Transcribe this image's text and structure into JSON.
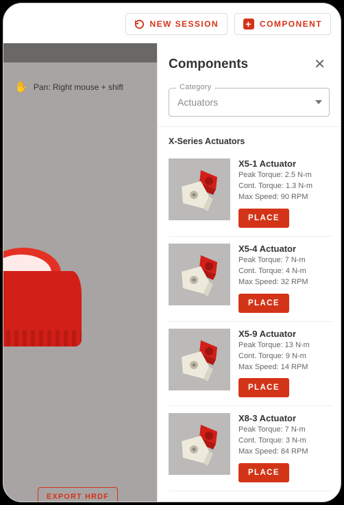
{
  "topbar": {
    "new_session_label": "NEW SESSION",
    "component_label": "COMPONENT"
  },
  "viewport": {
    "pan_hint": "Pan: Right mouse + shift",
    "export_label": "EXPORT HRDF"
  },
  "panel": {
    "title": "Components",
    "category_label": "Category",
    "category_value": "Actuators",
    "section_heading": "X-Series Actuators",
    "place_label": "PLACE",
    "items": [
      {
        "name": "X5-1 Actuator",
        "peak": "Peak Torque: 2.5 N-m",
        "cont": "Cont. Torque: 1.3 N-m",
        "speed": "Max Speed: 90 RPM"
      },
      {
        "name": "X5-4 Actuator",
        "peak": "Peak Torque: 7 N-m",
        "cont": "Cont. Torque: 4 N-m",
        "speed": "Max Speed: 32 RPM"
      },
      {
        "name": "X5-9 Actuator",
        "peak": "Peak Torque: 13 N-m",
        "cont": "Cont. Torque: 9 N-m",
        "speed": "Max Speed: 14 RPM"
      },
      {
        "name": "X8-3 Actuator",
        "peak": "Peak Torque: 7 N-m",
        "cont": "Cont. Torque: 3 N-m",
        "speed": "Max Speed: 84 RPM"
      }
    ]
  }
}
